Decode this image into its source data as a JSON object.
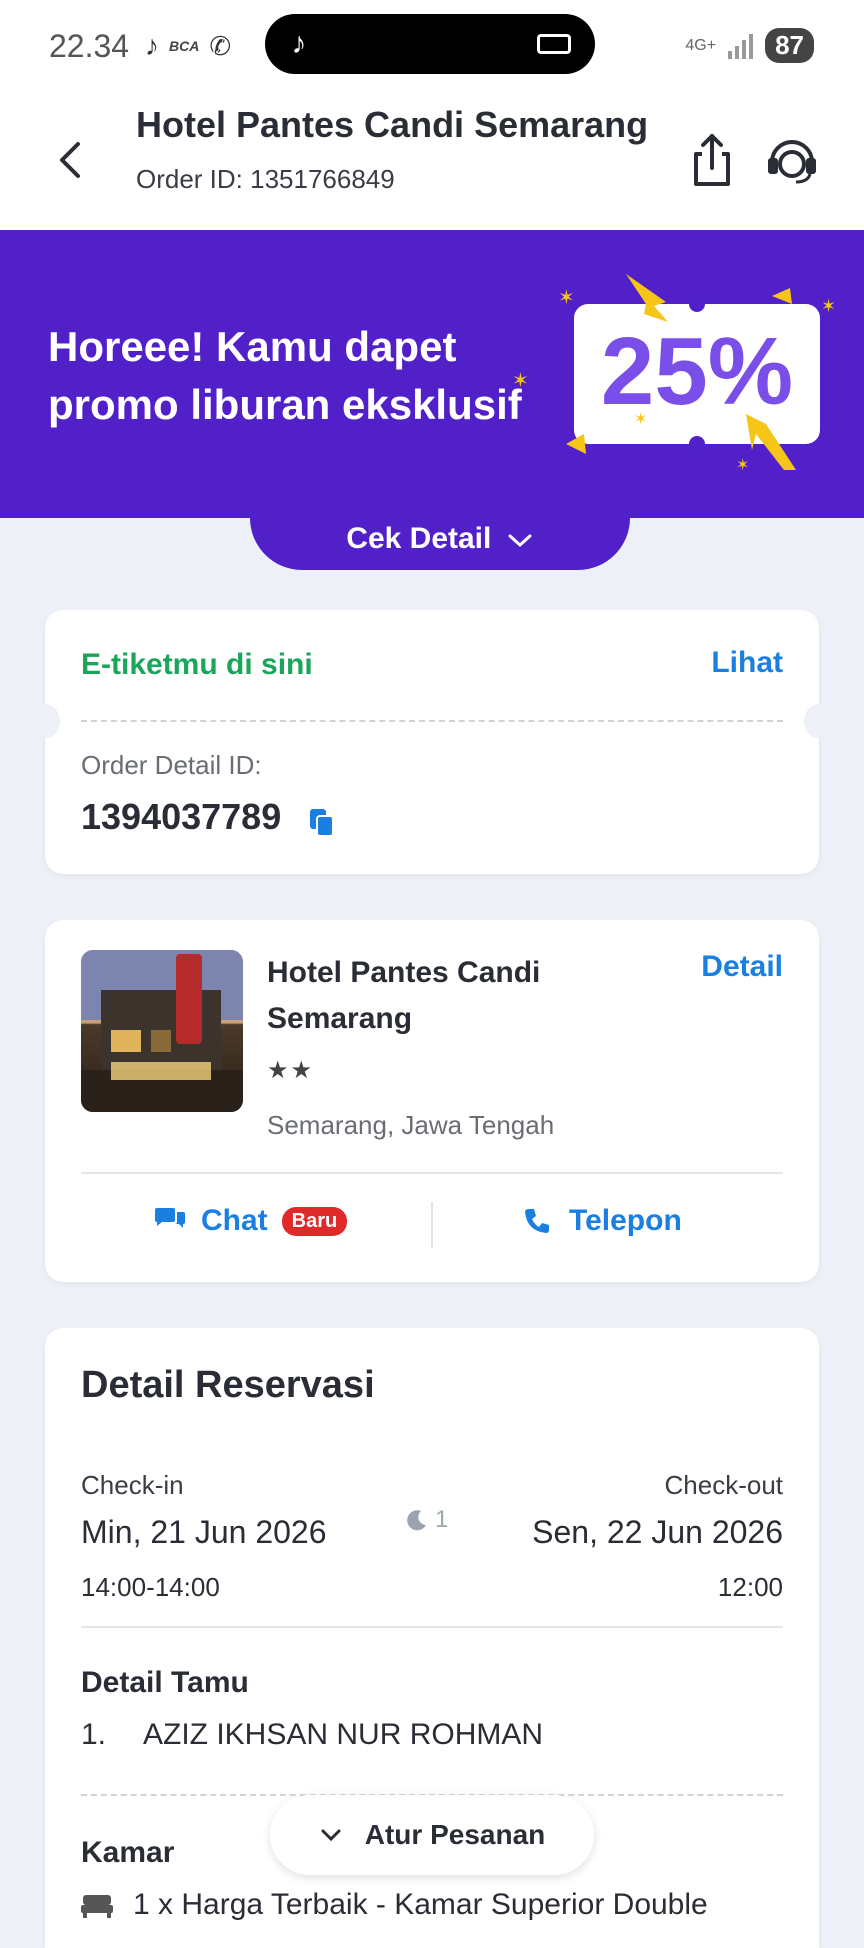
{
  "status_bar": {
    "time": "22.34",
    "network": "4G+",
    "battery": "87"
  },
  "header": {
    "title": "Hotel Pantes Candi Semarang",
    "order_id": "Order ID: 1351766849"
  },
  "promo": {
    "text": "Horeee! Kamu dapet promo liburan eksklusif",
    "badge": "25%",
    "cta": "Cek Detail"
  },
  "eticket": {
    "title": "E-tiketmu di sini",
    "action": "Lihat",
    "detail_label": "Order Detail ID:",
    "detail_id": "1394037789"
  },
  "hotel": {
    "name": "Hotel Pantes Candi Semarang",
    "detail_link": "Detail",
    "stars": "★★",
    "location": "Semarang, Jawa Tengah",
    "chat_label": "Chat",
    "chat_badge": "Baru",
    "phone_label": "Telepon"
  },
  "reservation": {
    "title": "Detail Reservasi",
    "checkin_label": "Check-in",
    "checkin_date": "Min, 21 Jun 2026",
    "checkin_time": "14:00-14:00",
    "nights": "1",
    "checkout_label": "Check-out",
    "checkout_date": "Sen, 22 Jun 2026",
    "checkout_time": "12:00",
    "guest_title": "Detail Tamu",
    "guest_number": "1.",
    "guest_name": "AZIZ IKHSAN NUR ROHMAN",
    "room_title": "Kamar",
    "room_desc": "1 x Harga Terbaik - Kamar Superior Double"
  },
  "floating_button": {
    "label": "Atur Pesanan"
  },
  "colors": {
    "brand_purple": "#5120c8",
    "link_blue": "#1a7fe0",
    "success_green": "#1aa55a",
    "badge_red": "#e02a2a"
  }
}
